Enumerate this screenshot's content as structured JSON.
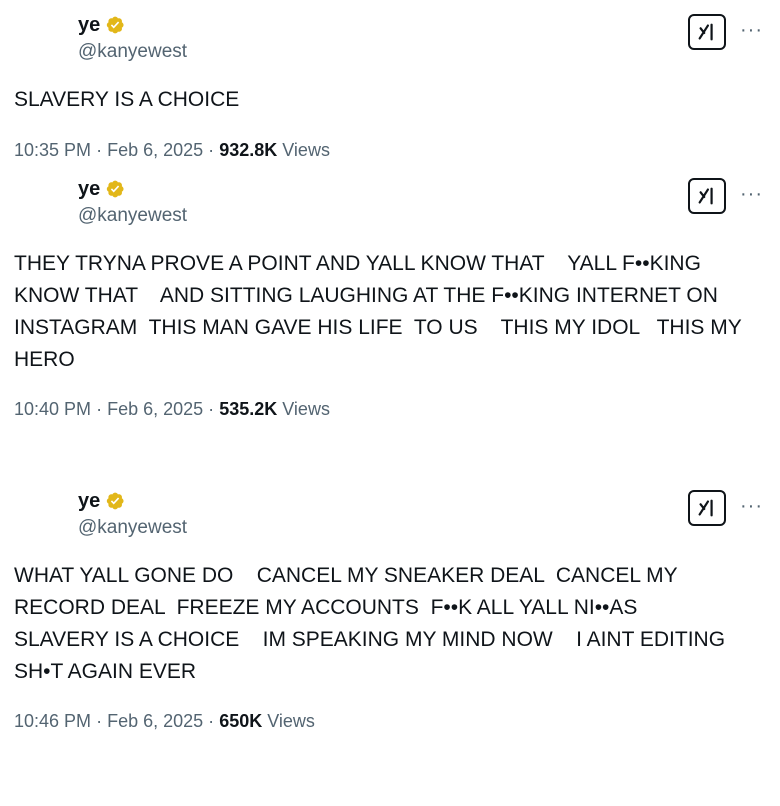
{
  "tweets": [
    {
      "name": "ye",
      "handle": "@kanyewest",
      "text": "SLAVERY IS A CHOICE",
      "time": "10:35 PM",
      "date": "Feb 6, 2025",
      "views_count": "932.8K",
      "views_label": "Views"
    },
    {
      "name": "ye",
      "handle": "@kanyewest",
      "text": "THEY TRYNA PROVE A POINT AND YALL KNOW THAT    YALL F••KING\nKNOW THAT    AND SITTING LAUGHING AT THE F••KING INTERNET ON\nINSTAGRAM  THIS MAN GAVE HIS LIFE  TO US    THIS MY IDOL   THIS MY\nHERO",
      "time": "10:40 PM",
      "date": "Feb 6, 2025",
      "views_count": "535.2K",
      "views_label": "Views"
    },
    {
      "name": "ye",
      "handle": "@kanyewest",
      "text": "WHAT YALL GONE DO    CANCEL MY SNEAKER DEAL  CANCEL MY\nRECORD DEAL  FREEZE MY ACCOUNTS  F••K ALL YALL NI••AS\nSLAVERY IS A CHOICE    IM SPEAKING MY MIND NOW    I AINT EDITING\nSH•T AGAIN EVER",
      "time": "10:46 PM",
      "date": "Feb 6, 2025",
      "views_count": "650K",
      "views_label": "Views"
    }
  ],
  "meta_separator": "·",
  "more_label": "···",
  "icons": {
    "verified": "verified-badge-icon",
    "grok": "grok-icon",
    "more": "more-icon"
  },
  "colors": {
    "verified_gold": "#e2b719",
    "text": "#0f1419",
    "secondary": "#536471"
  }
}
